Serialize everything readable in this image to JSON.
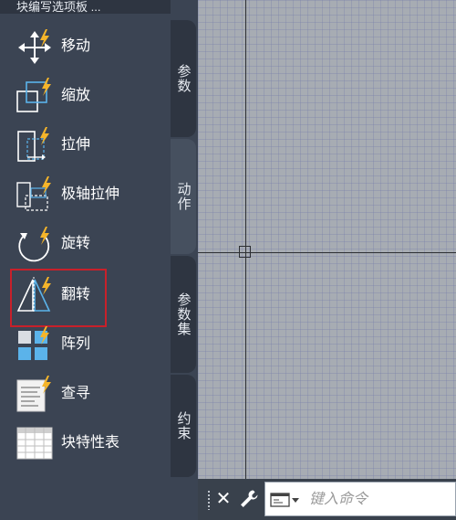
{
  "palette": {
    "title": "块编写选项板 ...",
    "tools": [
      {
        "label": "移动",
        "icon": "move-icon"
      },
      {
        "label": "缩放",
        "icon": "scale-icon"
      },
      {
        "label": "拉伸",
        "icon": "stretch-icon"
      },
      {
        "label": "极轴拉伸",
        "icon": "polar-stretch-icon"
      },
      {
        "label": "旋转",
        "icon": "rotate-icon"
      },
      {
        "label": "翻转",
        "icon": "flip-icon",
        "selected": true
      },
      {
        "label": "阵列",
        "icon": "array-icon"
      },
      {
        "label": "查寻",
        "icon": "lookup-icon"
      },
      {
        "label": "块特性表",
        "icon": "block-properties-table-icon"
      }
    ]
  },
  "tabs": [
    {
      "label": "参数",
      "active": false
    },
    {
      "label": "动作",
      "active": true
    },
    {
      "label": "参数集",
      "active": false
    },
    {
      "label": "约束",
      "active": false
    }
  ],
  "command_line": {
    "placeholder": "键入命令",
    "close_glyph": "✕"
  },
  "colors": {
    "accent_lightning": "#f5b52a",
    "selection_outline": "#c8202a",
    "icon_blue": "#5bb3ea"
  }
}
